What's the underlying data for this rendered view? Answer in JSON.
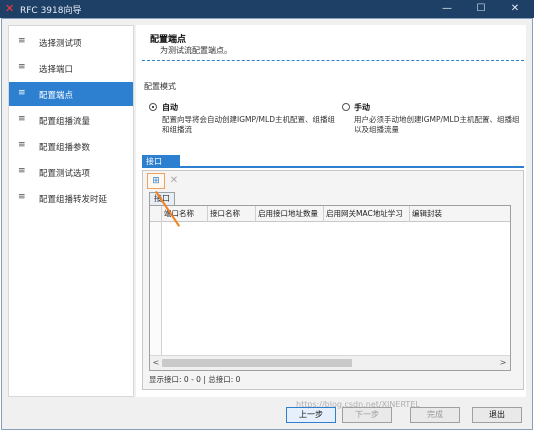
{
  "window": {
    "title": "RFC 3918向导",
    "logo": "✕",
    "minimize": "—",
    "maximize": "☐",
    "close": "✕"
  },
  "sidebar": {
    "items": [
      {
        "icon": "≡",
        "label": "选择测试项",
        "active": false
      },
      {
        "icon": "≡",
        "label": "选择端口",
        "active": false
      },
      {
        "icon": "≡",
        "label": "配置端点",
        "active": true
      },
      {
        "icon": "≡",
        "label": "配置组播流量",
        "active": false
      },
      {
        "icon": "≡",
        "label": "配置组播参数",
        "active": false
      },
      {
        "icon": "≡",
        "label": "配置测试选项",
        "active": false
      },
      {
        "icon": "≡",
        "label": "配置组播转发时延",
        "active": false
      }
    ]
  },
  "header": {
    "title": "配置端点",
    "subtitle": "为测试流配置端点。"
  },
  "mode": {
    "label": "配置模式",
    "auto": {
      "name": "自动",
      "desc_line1": "配置向导将会自动创建IGMP/MLD主机配置、组播组",
      "desc_line2": "和组播流",
      "selected": true
    },
    "manual": {
      "name": "手动",
      "desc_line1": "用户必须手动地创建IGMP/MLD主机配置、组播组",
      "desc_line2": "以及组播流量",
      "selected": false
    }
  },
  "tabs": {
    "interface_tab": "接口"
  },
  "toolbar": {
    "add_icon": "⊞",
    "delete_icon": "✕"
  },
  "grid": {
    "tab_label": "接口",
    "columns": [
      "端口名称",
      "接口名称",
      "启用接口地址数量",
      "启用网关MAC地址学习",
      "编辑封装"
    ],
    "scroll_left": "<",
    "scroll_right": ">"
  },
  "status": {
    "text": "显示接口: 0 - 0 | 总接口: 0"
  },
  "footer": {
    "prev": "上一步",
    "next": "下一步",
    "finish": "完成",
    "exit": "退出"
  },
  "watermark": "https://blog.csdn.net/XINERTEL"
}
